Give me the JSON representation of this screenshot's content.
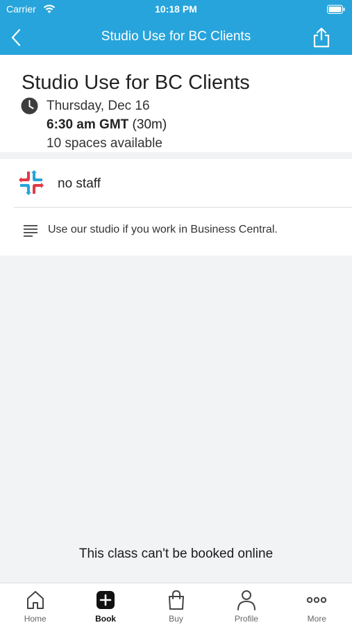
{
  "status_bar": {
    "carrier": "Carrier",
    "time": "10:18 PM"
  },
  "nav": {
    "title": "Studio Use for BC Clients",
    "back_icon": "chevron-left-icon",
    "share_icon": "share-icon"
  },
  "class": {
    "title": "Studio Use for BC Clients",
    "date": "Thursday, Dec 16",
    "time": "6:30 am GMT",
    "duration": "(30m)",
    "spaces": "10 spaces available"
  },
  "staff": {
    "name": "no staff"
  },
  "description": {
    "text": "Use our studio if you work in Business Central."
  },
  "footer": {
    "message": "This class can't be booked online"
  },
  "tabs": [
    {
      "label": "Home",
      "icon": "home-icon",
      "active": false
    },
    {
      "label": "Book",
      "icon": "plus-square-icon",
      "active": true
    },
    {
      "label": "Buy",
      "icon": "shopping-bag-icon",
      "active": false
    },
    {
      "label": "Profile",
      "icon": "person-icon",
      "active": false
    },
    {
      "label": "More",
      "icon": "ellipsis-icon",
      "active": false
    }
  ],
  "colors": {
    "brand": "#27a4db",
    "background": "#f2f3f5"
  }
}
